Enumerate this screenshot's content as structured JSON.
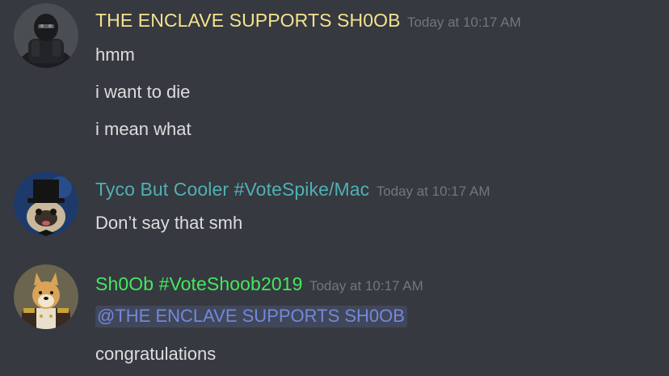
{
  "colors": {
    "background": "#36393f",
    "text": "#dcddde",
    "timestamp": "#72767d",
    "mention": "#7289da"
  },
  "messages": [
    {
      "author": "THE ENCLAVE SUPPORTS SH0OB",
      "author_color": "#f4e38f",
      "timestamp": "Today at 10:17 AM",
      "avatar_icon": "armored-soldier-avatar",
      "lines": [
        "hmm",
        "i want to die",
        "i mean what"
      ]
    },
    {
      "author": "Tyco But Cooler #VoteSpike/Mac",
      "author_color": "#4fb0b5",
      "timestamp": "Today at 10:17 AM",
      "avatar_icon": "pug-top-hat-avatar",
      "lines": [
        "Don’t say that smh"
      ]
    },
    {
      "author": "Sh0Ob #VoteShoob2019",
      "author_color": "#43e85d",
      "timestamp": "Today at 10:17 AM",
      "avatar_icon": "shiba-uniform-avatar",
      "mention": "@THE ENCLAVE SUPPORTS SH0OB",
      "lines": [
        "congratulations"
      ]
    }
  ]
}
